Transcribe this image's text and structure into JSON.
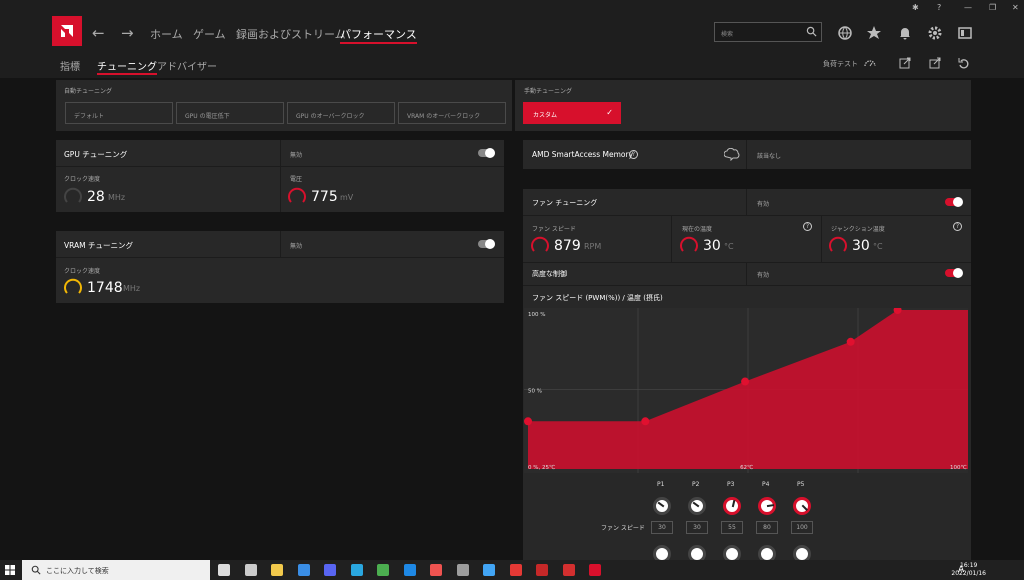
{
  "nav": {
    "back": "←",
    "forward": "→",
    "items": [
      "ホーム",
      "ゲーム",
      "録画およびストリーム",
      "パフォーマンス"
    ],
    "search_placeholder": "検索"
  },
  "subnav": {
    "items": [
      "指標",
      "チューニング",
      "アドバイザー"
    ],
    "stress_test": "負荷テスト"
  },
  "auto_tuning": {
    "label": "自動チューニング",
    "buttons": [
      "デフォルト",
      "GPU の電圧低下",
      "GPU のオーバークロック",
      "VRAM のオーバークロック"
    ]
  },
  "manual_tuning": {
    "label": "手動チューニング",
    "button": "カスタム",
    "check": "✓"
  },
  "gpu_tuning": {
    "title": "GPU チューニング",
    "state": "無効",
    "clock_label": "クロック速度",
    "clock_value": "28",
    "clock_unit": "MHz",
    "voltage_label": "電圧",
    "voltage_value": "775",
    "voltage_unit": "mV"
  },
  "vram_tuning": {
    "title": "VRAM チューニング",
    "state": "無効",
    "clock_label": "クロック速度",
    "clock_value": "1748",
    "clock_unit": "MHz"
  },
  "sam": {
    "title": "AMD SmartAccess Memory",
    "state": "該当なし",
    "help": "?"
  },
  "fan_tuning": {
    "title": "ファン チューニング",
    "state": "有効",
    "fan_speed_label": "ファン スピード",
    "fan_speed_value": "879",
    "fan_speed_unit": "RPM",
    "current_temp_label": "現在の温度",
    "current_temp_value": "30",
    "current_temp_unit": "°C",
    "junction_temp_label": "ジャンクション温度",
    "junction_temp_value": "30",
    "junction_temp_unit": "°C",
    "help": "?",
    "advanced_label": "高度な制御",
    "advanced_state": "有効",
    "curve_title": "ファン スピード (PWM(%)) / 温度 (摂氏)"
  },
  "chart_data": {
    "type": "area",
    "title": "ファン スピード (PWM(%)) / 温度 (摂氏)",
    "y_ticks": [
      "100 %",
      "50 %"
    ],
    "x_ticks": [
      "0 %, 25℃",
      "62℃",
      "100℃"
    ],
    "ylim": [
      0,
      100
    ],
    "xlim": [
      25,
      100
    ],
    "grid": true,
    "points": [
      {
        "x": 25,
        "y": 30
      },
      {
        "x": 45,
        "y": 30
      },
      {
        "x": 62,
        "y": 55
      },
      {
        "x": 80,
        "y": 80
      },
      {
        "x": 88,
        "y": 100
      },
      {
        "x": 100,
        "y": 100
      }
    ],
    "color": "#c8102e"
  },
  "fan_points": {
    "labels": [
      "P1",
      "P2",
      "P3",
      "P4",
      "P5"
    ],
    "row_label": "ファン スピード",
    "values": [
      "30",
      "30",
      "55",
      "80",
      "100"
    ]
  },
  "taskbar": {
    "search": "ここに入力して検索",
    "ime": "A",
    "time": "16:19",
    "date": "2022/01/16"
  },
  "colors": {
    "accent": "#d7102c",
    "bg": "#141414",
    "panel": "#282828"
  }
}
